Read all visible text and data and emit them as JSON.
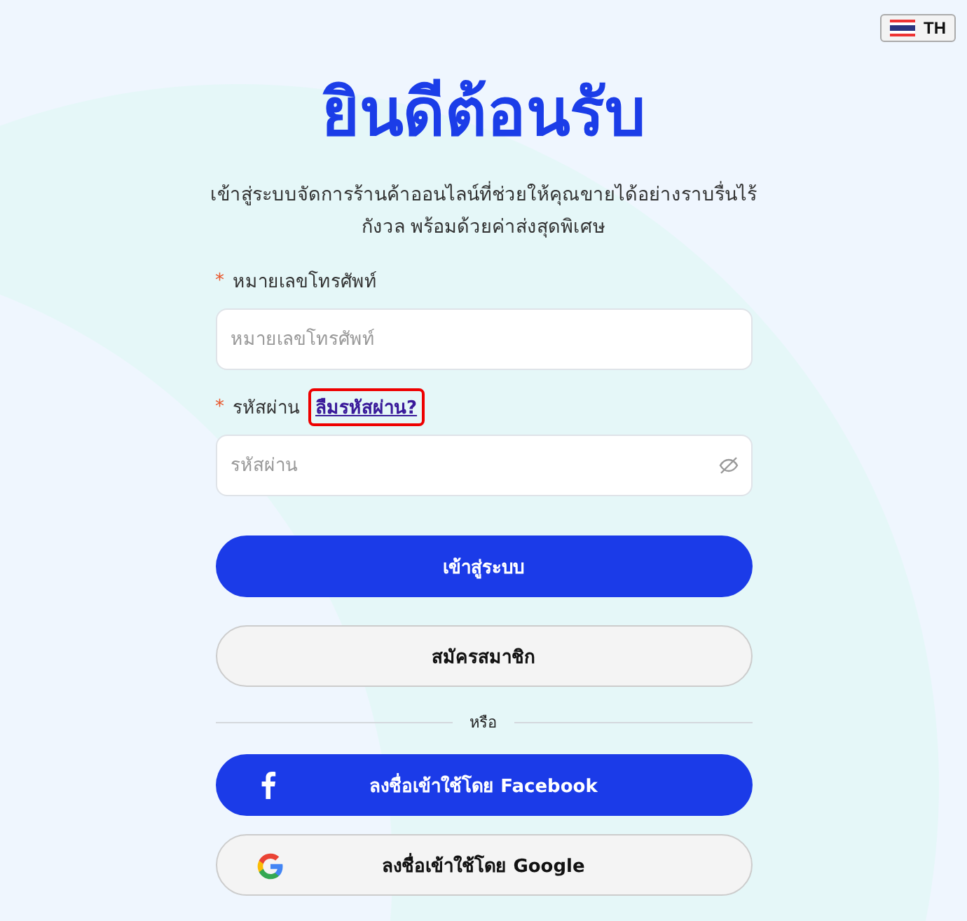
{
  "language": {
    "code": "TH"
  },
  "title": "ยินดีต้อนรับ",
  "subtitle": "เข้าสู่ระบบจัดการร้านค้าออนไลน์ที่ช่วยให้คุณขายได้อย่างราบรื่นไร้กังวล พร้อมด้วยค่าส่งสุดพิเศษ",
  "fields": [
    {
      "label": "หมายเลขโทรศัพท์",
      "required_mark": "*",
      "placeholder": "หมายเลขโทรศัพท์",
      "kind": "text"
    },
    {
      "label": "รหัสผ่าน",
      "required_mark": "*",
      "placeholder": "รหัสผ่าน",
      "kind": "password",
      "link": "ลืมรหัสผ่าน?"
    }
  ],
  "actions": [
    {
      "label": "เข้าสู่ระบบ",
      "kind": "primary"
    },
    {
      "label": "สมัครสมาชิก",
      "kind": "secondary"
    }
  ],
  "divider": "หรือ",
  "social": [
    {
      "label": "ลงชื่อเข้าใช้โดย Facebook",
      "kind": "facebook"
    },
    {
      "label": "ลงชื่อเข้าใช้โดย Google",
      "kind": "google"
    }
  ]
}
